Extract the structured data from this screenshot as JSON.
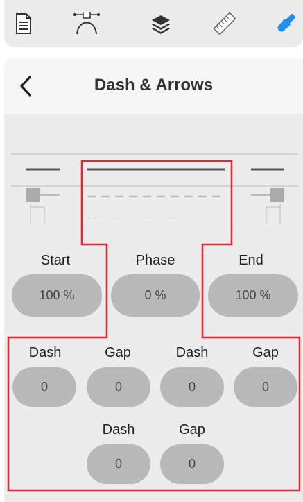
{
  "toolbar": {
    "icons": [
      "document-icon",
      "bezier-curve-icon",
      "layers-icon",
      "ruler-icon",
      "paint-brush-icon"
    ],
    "active_color": "#1e8ef0"
  },
  "header": {
    "title": "Dash & Arrows",
    "back_icon": "chevron-left-icon"
  },
  "arrows": {
    "start_label": "Start",
    "phase_label": "Phase",
    "end_label": "End",
    "start_value": "100 %",
    "phase_value": "0 %",
    "end_value": "100 %"
  },
  "dashes": {
    "labels": [
      "Dash",
      "Gap",
      "Dash",
      "Gap",
      "Dash",
      "Gap"
    ],
    "values": [
      "0",
      "0",
      "0",
      "0",
      "0",
      "0"
    ]
  },
  "highlight_color": "#e8242f"
}
